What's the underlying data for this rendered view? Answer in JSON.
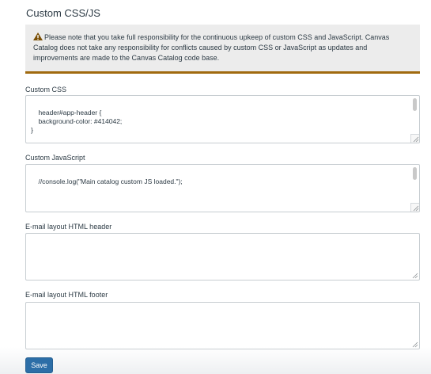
{
  "section": {
    "title": "Custom CSS/JS"
  },
  "notice": {
    "icon": "warning-icon",
    "text": "Please note that you take full responsibility for the continuous upkeep of custom CSS and JavaScript. Canvas Catalog does not take any responsibility for conflicts caused by custom CSS or JavaScript as updates and improvements are made to the Canvas Catalog code base.",
    "border_color": "#a06a0f",
    "background_color": "#ececec"
  },
  "fields": {
    "custom_css": {
      "label": "Custom CSS",
      "value": "header#app-header {\n    background-color: #414042;\n}"
    },
    "custom_js": {
      "label": "Custom JavaScript",
      "value": "//console.log(\"Main catalog custom JS loaded.\");"
    },
    "email_header": {
      "label": "E-mail layout HTML header",
      "value": ""
    },
    "email_footer": {
      "label": "E-mail layout HTML footer",
      "value": ""
    }
  },
  "actions": {
    "save_label": "Save",
    "save_color": "#2c6ea7"
  }
}
